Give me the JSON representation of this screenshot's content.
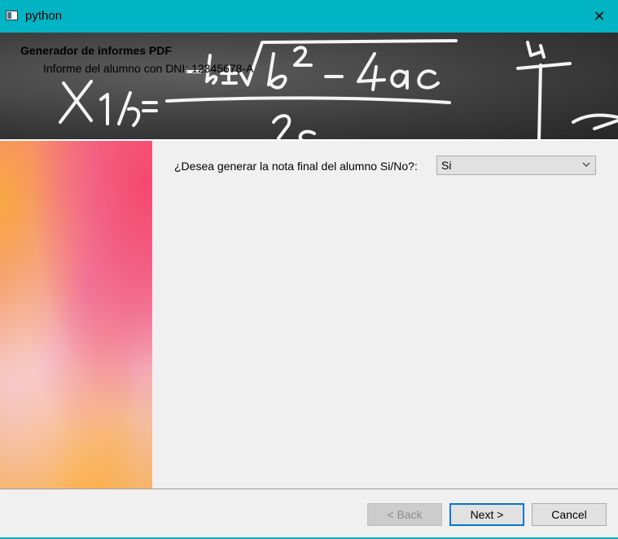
{
  "window": {
    "title": "python",
    "close_glyph": "✕",
    "accent_color": "#00b4c3",
    "icon": "app-window-icon"
  },
  "header": {
    "title": "Generador de informes PDF",
    "subtitle": "Informe del alumno con DNI: 12345678-A",
    "background": "chalkboard-quadratic-formula"
  },
  "form": {
    "question_label": "¿Desea generar la nota final del alumno Si/No?:",
    "selected_option": "Si"
  },
  "buttons": {
    "back": "< Back",
    "next": "Next >",
    "cancel": "Cancel"
  }
}
